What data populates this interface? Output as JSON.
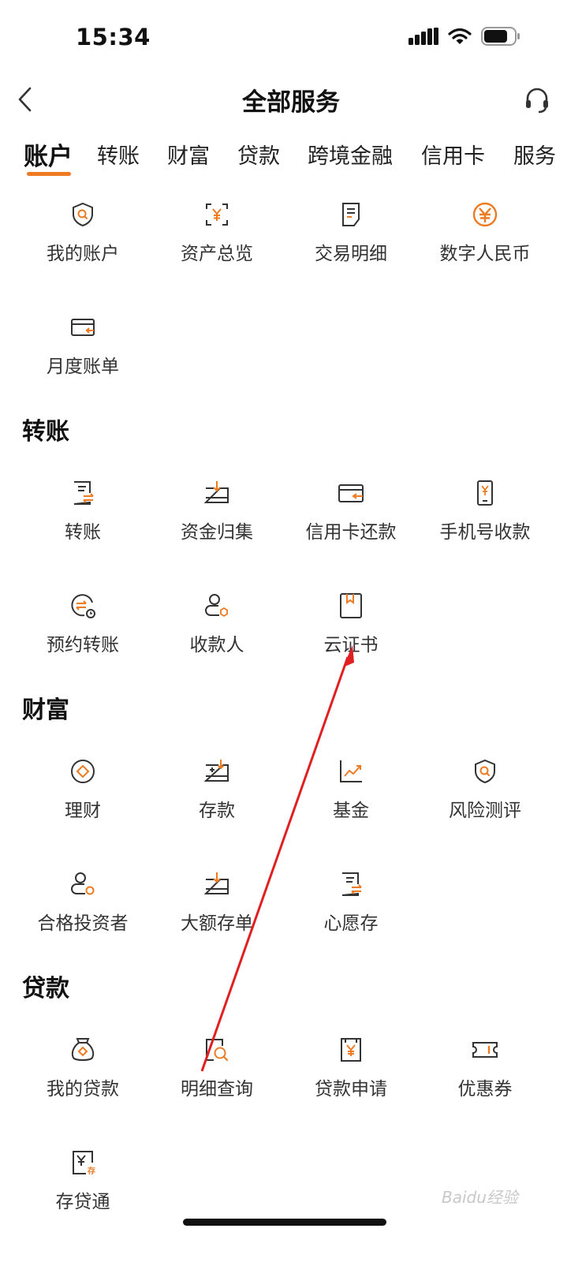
{
  "status_bar": {
    "time": "15:34"
  },
  "header": {
    "title": "全部服务"
  },
  "tabs": [
    {
      "label": "账户",
      "active": true
    },
    {
      "label": "转账"
    },
    {
      "label": "财富"
    },
    {
      "label": "贷款"
    },
    {
      "label": "跨境金融"
    },
    {
      "label": "信用卡"
    },
    {
      "label": "服务"
    }
  ],
  "accent_color": "#EE7A22",
  "sections": {
    "account": {
      "items": [
        {
          "label": "我的账户",
          "icon": "shield-search-icon"
        },
        {
          "label": "资产总览",
          "icon": "yuan-scan-icon"
        },
        {
          "label": "交易明细",
          "icon": "document-icon"
        },
        {
          "label": "数字人民币",
          "icon": "digital-rmb-icon"
        },
        {
          "label": "月度账单",
          "icon": "card-bill-icon"
        }
      ]
    },
    "transfer": {
      "title": "转账",
      "items": [
        {
          "label": "转账",
          "icon": "transfer-doc-icon"
        },
        {
          "label": "资金归集",
          "icon": "fund-collect-icon"
        },
        {
          "label": "信用卡还款",
          "icon": "card-repay-icon"
        },
        {
          "label": "手机号收款",
          "icon": "phone-receive-icon"
        },
        {
          "label": "预约转账",
          "icon": "scheduled-transfer-icon"
        },
        {
          "label": "收款人",
          "icon": "payee-icon"
        },
        {
          "label": "云证书",
          "icon": "cloud-certificate-icon"
        }
      ]
    },
    "wealth": {
      "title": "财富",
      "items": [
        {
          "label": "理财",
          "icon": "wealth-icon"
        },
        {
          "label": "存款",
          "icon": "deposit-icon"
        },
        {
          "label": "基金",
          "icon": "fund-chart-icon"
        },
        {
          "label": "风险测评",
          "icon": "risk-assessment-icon"
        },
        {
          "label": "合格投资者",
          "icon": "qualified-investor-icon"
        },
        {
          "label": "大额存单",
          "icon": "large-deposit-icon"
        },
        {
          "label": "心愿存",
          "icon": "wish-deposit-icon"
        }
      ]
    },
    "loan": {
      "title": "贷款",
      "items": [
        {
          "label": "我的贷款",
          "icon": "money-bag-icon"
        },
        {
          "label": "明细查询",
          "icon": "detail-search-icon"
        },
        {
          "label": "贷款申请",
          "icon": "loan-apply-icon"
        },
        {
          "label": "优惠券",
          "icon": "coupon-icon"
        },
        {
          "label": "存贷通",
          "icon": "deposit-loan-icon"
        }
      ]
    }
  },
  "watermark": "Baidu经验"
}
